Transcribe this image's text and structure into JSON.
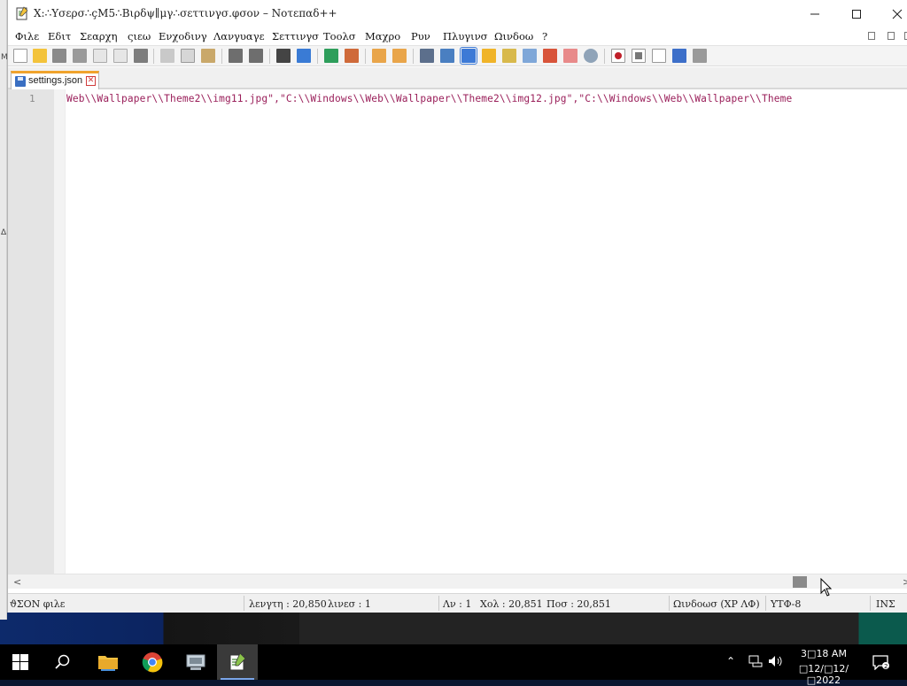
{
  "window": {
    "title": "X:∴Υσερσ∴çΜ5∴Βιρδψ∥μγ∴σεττινγσ.φσον – Νοτεπαδ++"
  },
  "menu": {
    "items": [
      "Φιλε",
      "Εδιτ",
      "Σεαρχη",
      "ςιεω",
      "Ενχοδινγ",
      "Λανγυαγε",
      "Σεττινγσ",
      "Τοολσ",
      "Μαχρο",
      "Ρυν",
      "Πλυγινσ",
      "Ωινδοω",
      "?"
    ]
  },
  "toolbar": {
    "icons": [
      "new-file-icon",
      "open-file-icon",
      "save-icon",
      "save-all-icon",
      "close-icon",
      "close-all-icon",
      "print-icon",
      "cut-icon",
      "copy-icon",
      "paste-icon",
      "undo-icon",
      "redo-icon",
      "find-icon",
      "replace-icon",
      "zoom-in-icon",
      "zoom-out-icon",
      "sync-vertical-icon",
      "sync-horizontal-icon",
      "word-wrap-icon",
      "show-all-chars-icon",
      "indent-guide-icon",
      "user-language-icon",
      "document-map-icon",
      "function-list-icon",
      "folder-workspace-icon",
      "monitoring-icon",
      "record-macro-icon",
      "stop-record-icon",
      "play-macro-icon",
      "run-macro-multiple-icon",
      "save-macro-icon"
    ]
  },
  "tabs": [
    {
      "label": "settings.json",
      "active": true
    }
  ],
  "editor": {
    "line_number": "1",
    "line_text": "Web\\\\Wallpaper\\\\Theme2\\\\img11.jpg\",\"C:\\\\Windows\\\\Web\\\\Wallpaper\\\\Theme2\\\\img12.jpg\",\"C:\\\\Windows\\\\Web\\\\Wallpaper\\\\Theme",
    "text_color": "#9a1f5a"
  },
  "scrollbar": {
    "horizontal_position": 0.9
  },
  "status": {
    "file_type": "ϑΣΟΝ φιλε",
    "length": "λενγτη : 20,850",
    "lines": "λινεσ : 1",
    "line": "Λν : 1",
    "col": "Χολ : 20,851",
    "pos": "Ποσ : 20,851",
    "eol": "Ωινδοωσ (ΧΡ ΛΦ)",
    "encoding": "ΥΤΦ-8",
    "mode": "ΙΝΣ"
  },
  "taskbar": {
    "apps": [
      "start-icon",
      "search-icon",
      "file-explorer-icon",
      "chrome-icon",
      "remote-desktop-icon",
      "notepadpp-icon"
    ],
    "time": "3□18 AM",
    "date": "□12/□12/□2022"
  },
  "desktop": {
    "edge_letters": [
      "M",
      "Δ"
    ]
  }
}
